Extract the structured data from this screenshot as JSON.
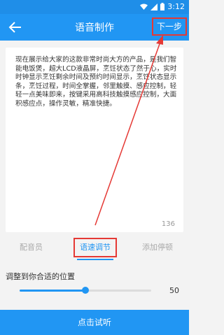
{
  "status_bar": {
    "time": "3:12",
    "icons": [
      "wifi-icon",
      "signal-icon",
      "battery-icon"
    ]
  },
  "app_bar": {
    "title": "语音制作",
    "back_icon": "arrow-left-icon",
    "next_label": "下一步"
  },
  "editor": {
    "text": "现在展示给大家的这款非常时尚大方的产品，是我们智能电饭煲，超大LCD液晶屏，烹饪状态了然于心，实时时钟显示烹饪剩余时间及预约时间显示，烹饪状态显示条，烹饪过程，时间全掌握，邻里触摸、感应控制，轻轻一点美味即来，按键采用高科技触摸感应控制，大面积感应点，操作灵敏，精准快捷。",
    "char_count": "136"
  },
  "tabs": [
    {
      "label": "配音员"
    },
    {
      "label": "语速调节"
    },
    {
      "label": "添加停顿"
    }
  ],
  "speed": {
    "label": "调整到你合适的位置",
    "value": "50",
    "level_fraction": 0.5
  },
  "bottom_button": {
    "label": "点击试听"
  },
  "colors": {
    "primary": "#2196f3",
    "highlight": "#e53935"
  }
}
